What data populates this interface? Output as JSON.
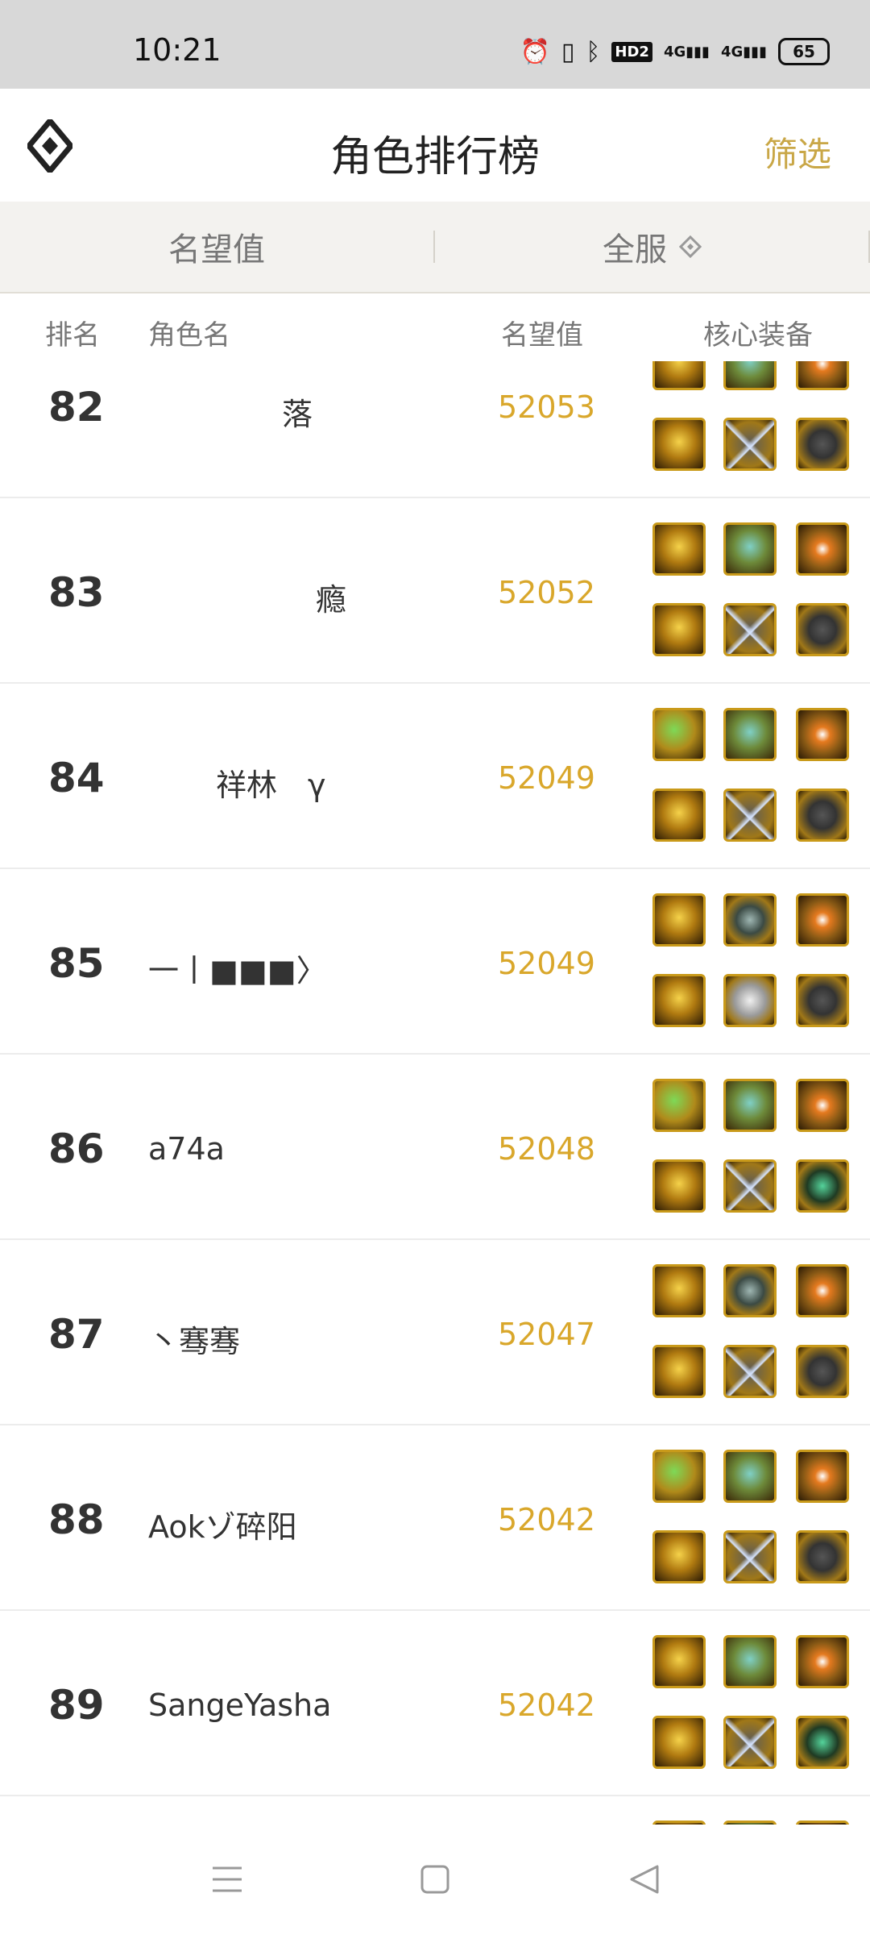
{
  "status_bar": {
    "time": "10:21",
    "hd_badge": "HD2",
    "net1": "4G",
    "net2": "4G",
    "battery": "65"
  },
  "header": {
    "title": "角色排行榜",
    "filter_label": "筛选"
  },
  "sort_bar": {
    "left_label": "名望值",
    "right_label": "全服"
  },
  "columns": {
    "rank": "排名",
    "name": "角色名",
    "reputation": "名望值",
    "equipment": "核心装备"
  },
  "rows": [
    {
      "rank": "82",
      "name": "落",
      "reputation": "52053"
    },
    {
      "rank": "83",
      "name": "瘾",
      "reputation": "52052"
    },
    {
      "rank": "84",
      "name": "祥林　γ",
      "reputation": "52049"
    },
    {
      "rank": "85",
      "name": "一丨■■■〉",
      "reputation": "52049"
    },
    {
      "rank": "86",
      "name": "a74a",
      "reputation": "52048"
    },
    {
      "rank": "87",
      "name": "丶骞骞",
      "reputation": "52047"
    },
    {
      "rank": "88",
      "name": "Aokゾ碎阳",
      "reputation": "52042"
    },
    {
      "rank": "89",
      "name": "SangeYasha",
      "reputation": "52042"
    }
  ],
  "colors": {
    "accent": "#c9a747",
    "reputation": "#d9a72b"
  }
}
